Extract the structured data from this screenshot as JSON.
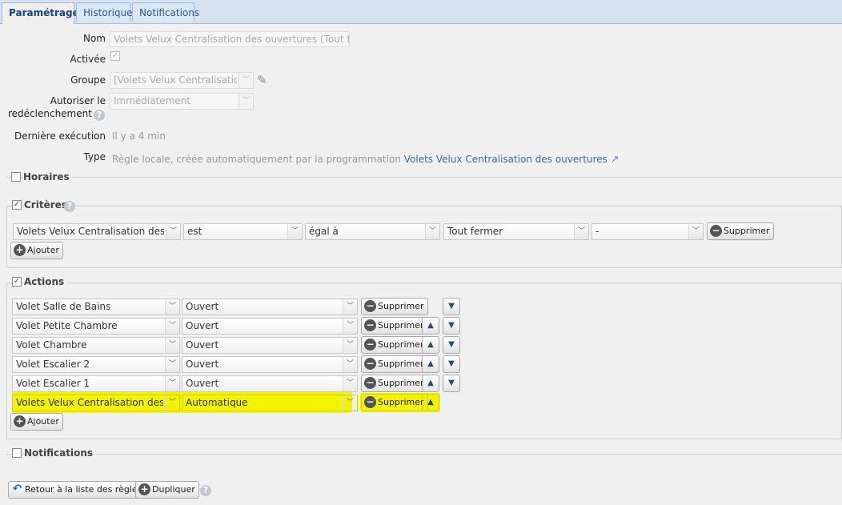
{
  "tabs": [
    {
      "label": "Paramétrage",
      "active": true
    },
    {
      "label": "Historique",
      "active": false
    },
    {
      "label": "Notifications",
      "active": false
    }
  ],
  "form": {
    "nom_label": "Nom",
    "nom_value": "Volets Velux Centralisation des ouvertures (Tout ferm",
    "activee_label": "Activée",
    "groupe_label": "Groupe",
    "groupe_value": "[Volets Velux Centralisation d",
    "autoriser_label_1": "Autoriser le",
    "autoriser_label_2": "redéclenchement",
    "autoriser_value": "Immédiatement",
    "derniere_label": "Dernière exécution",
    "derniere_value": "Il y a 4 min",
    "type_label": "Type",
    "type_value": "Règle locale, créée automatiquement par la programmation",
    "type_link": "Volets Velux Centralisation des ouvertures"
  },
  "horaires": {
    "label": "Horaires",
    "checked": false
  },
  "criteres": {
    "label": "Critères",
    "checked": true,
    "row": {
      "device": "Volets Velux Centralisation des ou",
      "verb": "est",
      "operator": "égal à",
      "value": "Tout fermer",
      "extra": "-"
    },
    "delete_label": "Supprimer",
    "add_label": "Ajouter"
  },
  "actions": {
    "label": "Actions",
    "checked": true,
    "rows": [
      {
        "device": "Volet Salle de Bains",
        "state": "Ouvert"
      },
      {
        "device": "Volet Petite Chambre",
        "state": "Ouvert"
      },
      {
        "device": "Volet Chambre",
        "state": "Ouvert"
      },
      {
        "device": "Volet Escalier 2",
        "state": "Ouvert"
      },
      {
        "device": "Volet Escalier 1",
        "state": "Ouvert"
      },
      {
        "device": "Volets Velux Centralisation des ou",
        "state": "Automatique"
      }
    ],
    "delete_label": "Supprimer",
    "add_label": "Ajouter",
    "highlight_color": "#f3f300"
  },
  "notifications": {
    "label": "Notifications",
    "checked": false
  },
  "footer": {
    "back_label": "Retour à la liste des règles",
    "duplicate_label": "Dupliquer"
  },
  "colors": {
    "tab_bar": "#d6e2ef",
    "link": "#3b6aa8",
    "background": "#f0f0f0"
  }
}
